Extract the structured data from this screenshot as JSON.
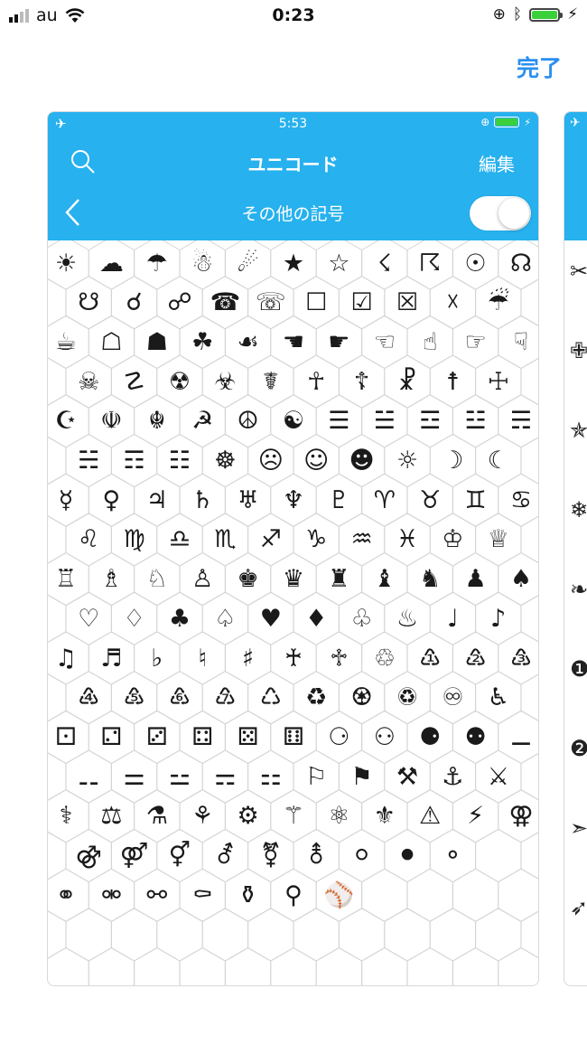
{
  "status_bar": {
    "carrier": "au",
    "time": "0:23",
    "battery_fill_fraction": 1.0
  },
  "header": {
    "done_label": "完了"
  },
  "card": {
    "status": {
      "time": "5:53"
    },
    "nav": {
      "title": "ユニコード",
      "edit_label": "編集"
    },
    "category": {
      "title": "その他の記号",
      "toggle_on": true
    },
    "colors": {
      "header_bg": "#27b1ee",
      "accent": "#2a8ff0"
    },
    "rows": [
      [
        "☀",
        "☁",
        "☂",
        "☃",
        "☄",
        "★",
        "☆",
        "☇",
        "☈",
        "☉",
        "☊"
      ],
      [
        "☋",
        "☌",
        "☍",
        "☎",
        "☏",
        "☐",
        "☑",
        "☒",
        "☓",
        "☔"
      ],
      [
        "☕",
        "☖",
        "☗",
        "☘",
        "☙",
        "☚",
        "☛",
        "☜",
        "☝",
        "☞",
        "☟"
      ],
      [
        "☠",
        "☡",
        "☢",
        "☣",
        "☤",
        "☥",
        "☦",
        "☧",
        "☨",
        "☩"
      ],
      [
        "☪",
        "☫",
        "☬",
        "☭",
        "☮",
        "☯",
        "☰",
        "☱",
        "☲",
        "☳",
        "☴"
      ],
      [
        "☵",
        "☶",
        "☷",
        "☸",
        "☹",
        "☺",
        "☻",
        "☼",
        "☽",
        "☾"
      ],
      [
        "☿",
        "♀",
        "♃",
        "♄",
        "♅",
        "♆",
        "♇",
        "♈",
        "♉",
        "♊",
        "♋"
      ],
      [
        "♌",
        "♍",
        "♎",
        "♏",
        "♐",
        "♑",
        "♒",
        "♓",
        "♔",
        "♕"
      ],
      [
        "♖",
        "♗",
        "♘",
        "♙",
        "♚",
        "♛",
        "♜",
        "♝",
        "♞",
        "♟",
        "♠"
      ],
      [
        "♡",
        "♢",
        "♣",
        "♤",
        "♥",
        "♦",
        "♧",
        "♨",
        "♩",
        "♪"
      ],
      [
        "♫",
        "♬",
        "♭",
        "♮",
        "♯",
        "♰",
        "♱",
        "♲",
        "♳",
        "♴",
        "♵"
      ],
      [
        "♶",
        "♷",
        "♸",
        "♹",
        "♺",
        "♻",
        "♼",
        "♽",
        "♾",
        "♿"
      ],
      [
        "⚀",
        "⚁",
        "⚂",
        "⚃",
        "⚄",
        "⚅",
        "⚆",
        "⚇",
        "⚈",
        "⚉",
        "⚊"
      ],
      [
        "⚋",
        "⚌",
        "⚍",
        "⚎",
        "⚏",
        "⚐",
        "⚑",
        "⚒",
        "⚓",
        "⚔"
      ],
      [
        "⚕",
        "⚖",
        "⚗",
        "⚘",
        "⚙",
        "⚚",
        "⚛",
        "⚜",
        "⚠",
        "⚡",
        "⚢"
      ],
      [
        "⚣",
        "⚤",
        "⚥",
        "⚦",
        "⚧",
        "⚨",
        "⚪",
        "⚫",
        "⚬"
      ],
      [
        "⚭",
        "⚮",
        "⚯",
        "⚰",
        "⚱",
        "⚲",
        "⚾"
      ]
    ]
  },
  "peek_card": {
    "symbols": [
      "✂",
      "✙",
      "✯",
      "❄",
      "❧",
      "❶",
      "❷",
      "➣",
      "➶"
    ]
  }
}
